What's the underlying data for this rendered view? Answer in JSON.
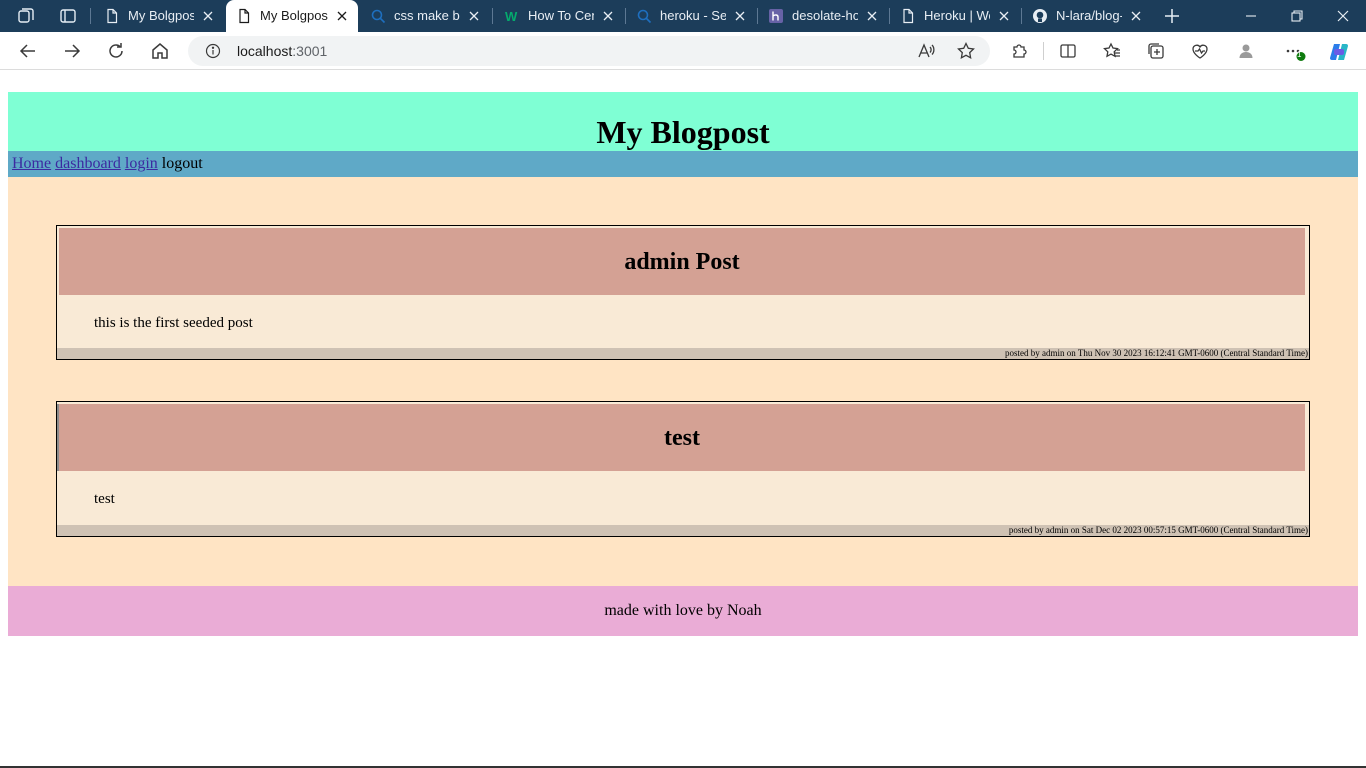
{
  "browser": {
    "tabs": [
      {
        "title": "My Bolgpost",
        "icon": "page-icon",
        "active": false
      },
      {
        "title": "My Bolgpost",
        "icon": "page-icon",
        "active": true
      },
      {
        "title": "css make but",
        "icon": "search-icon",
        "active": false
      },
      {
        "title": "How To Cent",
        "icon": "w3schools-icon",
        "active": false
      },
      {
        "title": "heroku - Sea",
        "icon": "search-icon",
        "active": false
      },
      {
        "title": "desolate-holl",
        "icon": "heroku-icon",
        "active": false
      },
      {
        "title": "Heroku | We",
        "icon": "page-icon",
        "active": false
      },
      {
        "title": "N-lara/blog-",
        "icon": "github-icon",
        "active": false
      }
    ],
    "address": {
      "host": "localhost",
      "port": ":3001"
    },
    "extensions_badge": "1"
  },
  "page": {
    "site_title": "My Blogpost",
    "nav": {
      "home": "Home",
      "dashboard": "dashboard",
      "login": "login",
      "logout": "logout"
    },
    "posts": [
      {
        "title": "admin Post",
        "body": "this is the first seeded post",
        "meta": "posted by admin on Thu Nov 30 2023 16:12:41 GMT-0600 (Central Standard Time)"
      },
      {
        "title": "test",
        "body": "test",
        "meta": "posted by admin on Sat Dec 02 2023 00:57:15 GMT-0600 (Central Standard Time)"
      }
    ],
    "footer": "made with love by Noah"
  },
  "colors": {
    "tabbar": "#1c3d5a",
    "header": "#7fffd4",
    "nav": "#5fa9c7",
    "main": "#ffe4c4",
    "post_head": "#d4a194",
    "post_body": "#f9ead6",
    "post_foot": "#cfc2b4",
    "footer": "#eaacd6"
  }
}
